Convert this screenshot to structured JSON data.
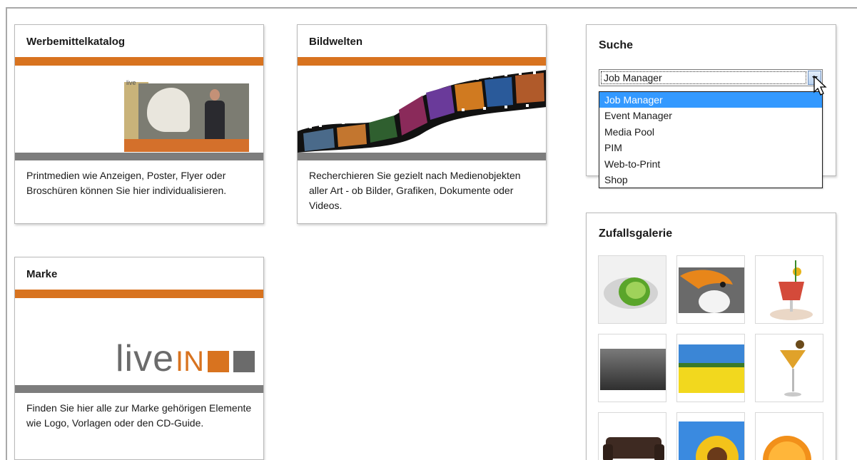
{
  "cards": {
    "werbemittel": {
      "title": "Werbemittelkatalog",
      "description": "Printmedien wie Anzeigen, Poster, Flyer oder Broschüren können Sie hier individualisieren.",
      "image_logo_text": "live"
    },
    "bildwelten": {
      "title": "Bildwelten",
      "description": "Recherchieren Sie gezielt nach Medienobjekten aller Art - ob Bilder, Grafiken, Dokumente oder Videos."
    },
    "marke": {
      "title": "Marke",
      "description": "Finden Sie hier alle zur Marke gehörigen Elemente wie Logo, Vorlagen oder den CD-Guide.",
      "logo_live": "live",
      "logo_in": "IN"
    }
  },
  "search": {
    "title": "Suche",
    "selected": "Job Manager",
    "options": [
      "Job Manager",
      "Event Manager",
      "Media Pool",
      "PIM",
      "Web-to-Print",
      "Shop"
    ],
    "highlighted_index": 0
  },
  "gallery": {
    "title": "Zufallsgalerie",
    "items": [
      "lime-splash-image",
      "toucan-image",
      "cocktail-glass-image",
      "gray-gradient-image",
      "rapeseed-field-image",
      "martini-glass-image",
      "leather-sofa-image",
      "sunflower-image",
      "orange-slices-image"
    ]
  },
  "colors": {
    "accent_orange": "#d8731f",
    "bar_gray": "#7d7d7d",
    "selection_blue": "#3399ff"
  }
}
